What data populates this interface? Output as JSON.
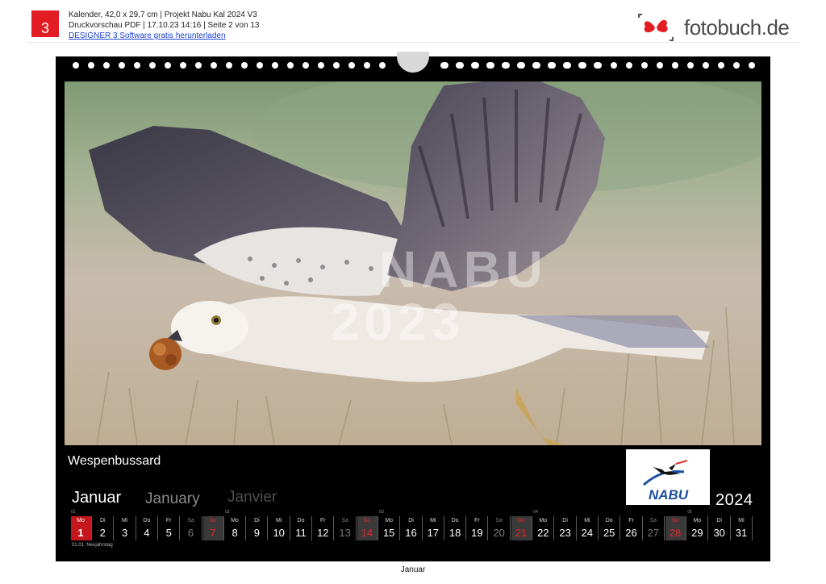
{
  "header": {
    "page_number": "3",
    "line1": "Kalender, 42,0 x 29,7 cm | Projekt Nabu Kal 2024 V3",
    "line2": "Druckvorschau PDF | 17.10.23 14:16 | Seite 2 von 13",
    "link": "DESIGNER 3 Software gratis herunterladen",
    "brand": "fotobuch.de",
    "brand_accent": "#e31b23"
  },
  "calendar": {
    "photo_watermark_line1": "NABU",
    "photo_watermark_line2": "2023",
    "caption": "Wespenbussard",
    "logo_text": "NABU",
    "month_de": "Januar",
    "month_en": "January",
    "month_fr": "Janvier",
    "year": "2024",
    "holiday_note": "01.01. Neujahrstag",
    "days": [
      {
        "n": "1",
        "d": "Mo",
        "t": "today",
        "w": "01"
      },
      {
        "n": "2",
        "d": "Di",
        "t": ""
      },
      {
        "n": "3",
        "d": "Mi",
        "t": ""
      },
      {
        "n": "4",
        "d": "Do",
        "t": ""
      },
      {
        "n": "5",
        "d": "Fr",
        "t": ""
      },
      {
        "n": "6",
        "d": "Sa",
        "t": "sat"
      },
      {
        "n": "7",
        "d": "So",
        "t": "sun"
      },
      {
        "n": "8",
        "d": "Mo",
        "t": "",
        "w": "02"
      },
      {
        "n": "9",
        "d": "Di",
        "t": ""
      },
      {
        "n": "10",
        "d": "Mi",
        "t": ""
      },
      {
        "n": "11",
        "d": "Do",
        "t": ""
      },
      {
        "n": "12",
        "d": "Fr",
        "t": ""
      },
      {
        "n": "13",
        "d": "Sa",
        "t": "sat"
      },
      {
        "n": "14",
        "d": "So",
        "t": "sun"
      },
      {
        "n": "15",
        "d": "Mo",
        "t": "",
        "w": "03"
      },
      {
        "n": "16",
        "d": "Di",
        "t": ""
      },
      {
        "n": "17",
        "d": "Mi",
        "t": ""
      },
      {
        "n": "18",
        "d": "Do",
        "t": ""
      },
      {
        "n": "19",
        "d": "Fr",
        "t": ""
      },
      {
        "n": "20",
        "d": "Sa",
        "t": "sat"
      },
      {
        "n": "21",
        "d": "So",
        "t": "sun"
      },
      {
        "n": "22",
        "d": "Mo",
        "t": "",
        "w": "04"
      },
      {
        "n": "23",
        "d": "Di",
        "t": ""
      },
      {
        "n": "24",
        "d": "Mi",
        "t": ""
      },
      {
        "n": "25",
        "d": "Do",
        "t": ""
      },
      {
        "n": "26",
        "d": "Fr",
        "t": ""
      },
      {
        "n": "27",
        "d": "Sa",
        "t": "sat"
      },
      {
        "n": "28",
        "d": "So",
        "t": "sun"
      },
      {
        "n": "29",
        "d": "Mo",
        "t": "",
        "w": "05"
      },
      {
        "n": "30",
        "d": "Di",
        "t": ""
      },
      {
        "n": "31",
        "d": "Mi",
        "t": ""
      }
    ]
  },
  "footer": {
    "label": "Januar"
  }
}
